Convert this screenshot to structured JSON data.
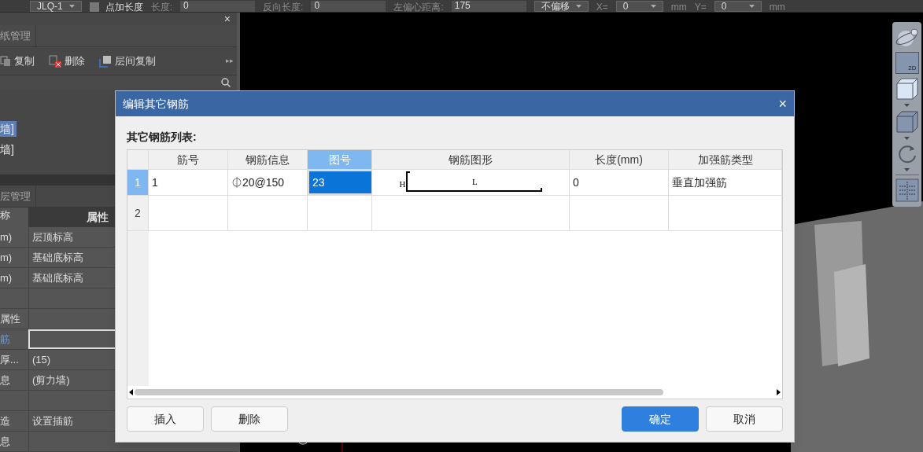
{
  "top_bar": {
    "items": [
      {
        "kind": "dropdown",
        "text": "JLQ-1"
      },
      {
        "kind": "checkbox",
        "text": "点加长度",
        "checked": false
      },
      {
        "kind": "label",
        "text": "长度:"
      },
      {
        "kind": "field",
        "text": "0"
      },
      {
        "kind": "label",
        "text": "反向长度:"
      },
      {
        "kind": "field",
        "text": "0"
      },
      {
        "kind": "label",
        "text": "左偏心距离:"
      },
      {
        "kind": "field",
        "text": "175"
      },
      {
        "kind": "dropdown",
        "text": "不偏移"
      },
      {
        "kind": "label",
        "text": "X="
      },
      {
        "kind": "dropdown",
        "text": "0"
      },
      {
        "kind": "label",
        "text": "mm"
      },
      {
        "kind": "label",
        "text": "Y="
      },
      {
        "kind": "dropdown",
        "text": "0"
      },
      {
        "kind": "label",
        "text": "mm"
      }
    ]
  },
  "left_panel": {
    "close": "×",
    "tab": "纸管理",
    "toolbar": [
      {
        "label": "复制",
        "kind": "copy"
      },
      {
        "label": "删除",
        "kind": "delete"
      },
      {
        "label": "层间复制",
        "kind": "floor-copy"
      }
    ],
    "more": "▸▸",
    "tree": [
      {
        "label": "墙]",
        "selected": true
      },
      {
        "label": "墙]",
        "selected": false
      }
    ],
    "properties_tab": "层管理",
    "properties_columns": [
      "称",
      "属性"
    ],
    "properties": [
      {
        "name": "m)",
        "value": "层顶标高",
        "kind": "row"
      },
      {
        "name": "m)",
        "value": "基础底标高",
        "kind": "row"
      },
      {
        "name": "m)",
        "value": "基础底标高",
        "kind": "row"
      },
      {
        "kind": "row"
      },
      {
        "name": "属性",
        "kind": "row"
      },
      {
        "name": "筋",
        "kind": "input"
      },
      {
        "name": "厚...",
        "value": "(15)",
        "kind": "row"
      },
      {
        "name": "息",
        "value": "(剪力墙)",
        "kind": "row"
      },
      {
        "kind": "row"
      },
      {
        "name": "造",
        "value": "设置插筋",
        "kind": "row"
      },
      {
        "name": "息",
        "kind": "row"
      }
    ]
  },
  "view_toolbar": {
    "badge_2d": "2D"
  },
  "dialog": {
    "title": "编辑其它钢筋",
    "close": "×",
    "list_label": "其它钢筋列表:",
    "columns": [
      {
        "label": "筋号",
        "selected": false
      },
      {
        "label": "钢筋信息",
        "selected": false
      },
      {
        "label": "图号",
        "selected": true
      },
      {
        "label": "钢筋图形",
        "selected": false
      },
      {
        "label": "长度(mm)",
        "selected": false
      },
      {
        "label": "加强筋类型",
        "selected": false
      }
    ],
    "rows": [
      {
        "number": "1",
        "selected": true,
        "cells": [
          {
            "text": "1",
            "selected": false
          },
          {
            "text": "⏀20@150",
            "selected": false
          },
          {
            "text": "23",
            "selected": true
          },
          {
            "kind": "shape",
            "h": "H",
            "l": "L",
            "selected": false
          },
          {
            "text": "0",
            "selected": false
          },
          {
            "text": "垂直加强筋",
            "selected": false
          }
        ]
      },
      {
        "number": "2",
        "selected": false,
        "cells": [
          {
            "selected": false
          },
          {
            "selected": false
          },
          {
            "selected": false
          },
          {
            "selected": false
          },
          {
            "selected": false
          },
          {
            "selected": false
          }
        ]
      }
    ],
    "buttons": [
      {
        "label": "插入",
        "primary": false
      },
      {
        "label": "删除",
        "primary": false
      },
      {
        "label": "确定",
        "primary": true
      },
      {
        "label": "取消",
        "primary": false
      }
    ]
  }
}
